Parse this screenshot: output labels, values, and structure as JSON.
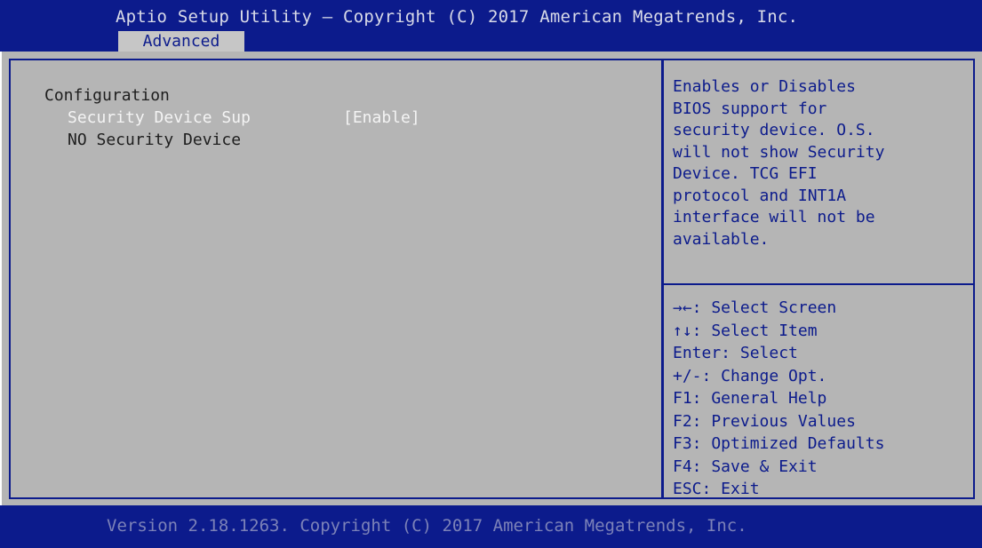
{
  "header": {
    "title": "Aptio Setup Utility – Copyright (C) 2017 American Megatrends, Inc.",
    "active_tab": "Advanced"
  },
  "main": {
    "section_title": "Configuration",
    "items": [
      {
        "label": "Security Device Sup",
        "value": "[Enable]",
        "selected": true
      },
      {
        "label": "NO Security Device",
        "value": "",
        "selected": false
      }
    ]
  },
  "help": {
    "lines": [
      "Enables or Disables",
      "BIOS support for",
      "security device. O.S.",
      "will not show Security",
      "Device. TCG EFI",
      "protocol and INT1A",
      "interface will not be",
      "available."
    ]
  },
  "keys": [
    "→←: Select Screen",
    "↑↓: Select Item",
    "Enter: Select",
    "+/-: Change Opt.",
    "F1: General Help",
    "F2: Previous Values",
    "F3: Optimized Defaults",
    "F4: Save & Exit",
    "ESC: Exit"
  ],
  "footer": {
    "text": "Version 2.18.1263. Copyright (C) 2017 American Megatrends, Inc."
  },
  "colors": {
    "bios_blue": "#0c1b8c",
    "panel_gray": "#b5b5b5",
    "selected_text": "#f4f4f4",
    "tab_bg": "#c6c6c6"
  }
}
